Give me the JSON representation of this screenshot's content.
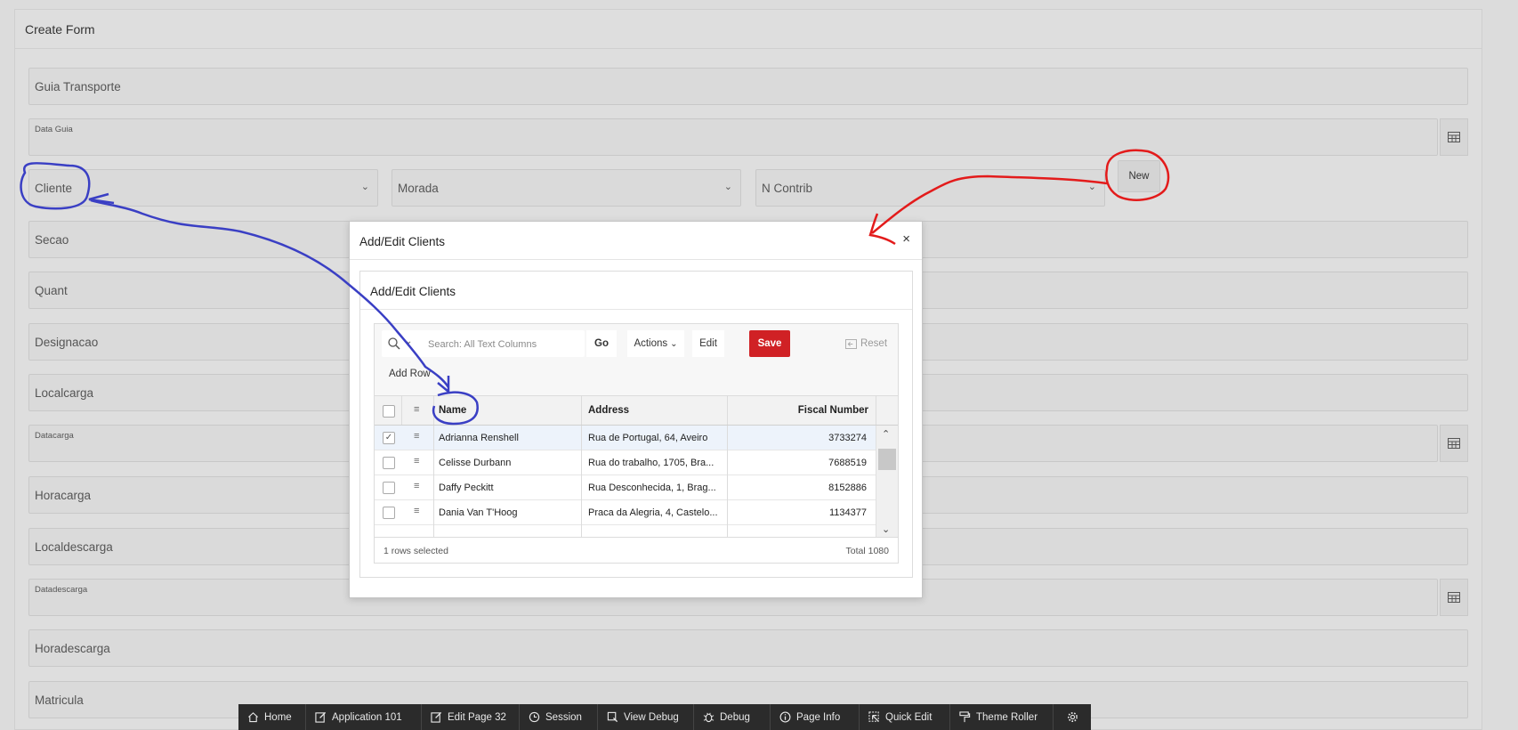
{
  "region": {
    "title": "Create Form"
  },
  "fields": {
    "guia_transporte": "Guia Transporte",
    "data_guia": "Data Guia",
    "cliente": "Cliente",
    "morada": "Morada",
    "n_contrib": "N Contrib",
    "secao": "Secao",
    "quant": "Quant",
    "designacao": "Designacao",
    "localcarga": "Localcarga",
    "datacarga": "Datacarga",
    "horacarga": "Horacarga",
    "localdescarga": "Localdescarga",
    "datadescarga": "Datadescarga",
    "horadescarga": "Horadescarga",
    "matricula": "Matricula"
  },
  "new_button": "New",
  "dialog": {
    "title": "Add/Edit Clients",
    "close": "×",
    "region_title": "Add/Edit Clients",
    "toolbar": {
      "search_placeholder": "Search: All Text Columns",
      "go": "Go",
      "actions": "Actions",
      "edit": "Edit",
      "save": "Save",
      "reset": "Reset",
      "add_row": "Add Row"
    },
    "columns": {
      "name": "Name",
      "address": "Address",
      "fiscal_number": "Fiscal Number"
    },
    "rows": [
      {
        "name": "Adrianna Renshell",
        "address": "Rua de Portugal, 64, Aveiro",
        "fiscal": "3733274",
        "selected": true
      },
      {
        "name": "Celisse Durbann",
        "address": "Rua do trabalho, 1705, Bra...",
        "fiscal": "7688519",
        "selected": false
      },
      {
        "name": "Daffy Peckitt",
        "address": "Rua Desconhecida, 1, Brag...",
        "fiscal": "8152886",
        "selected": false
      },
      {
        "name": "Dania Van T'Hoog",
        "address": "Praca da Alegria, 4, Castelo...",
        "fiscal": "1134377",
        "selected": false
      }
    ],
    "footer": {
      "rows_selected": "1 rows selected",
      "total": "Total 1080"
    }
  },
  "dev_toolbar": [
    {
      "label": "Home",
      "icon": "home-icon"
    },
    {
      "label": "Application 101",
      "icon": "edit-icon"
    },
    {
      "label": "Edit Page 32",
      "icon": "edit-page-icon"
    },
    {
      "label": "Session",
      "icon": "clock-icon"
    },
    {
      "label": "View Debug",
      "icon": "view-debug-icon"
    },
    {
      "label": "Debug",
      "icon": "bug-icon"
    },
    {
      "label": "Page Info",
      "icon": "info-icon"
    },
    {
      "label": "Quick Edit",
      "icon": "quick-edit-icon"
    },
    {
      "label": "Theme Roller",
      "icon": "paint-roller-icon"
    },
    {
      "label": "",
      "icon": "gear-icon"
    }
  ],
  "colors": {
    "save_button": "#d02125",
    "annotation_blue": "#3a3fc4",
    "annotation_red": "#e31b1b",
    "dev_toolbar": "#2b2b2b"
  }
}
